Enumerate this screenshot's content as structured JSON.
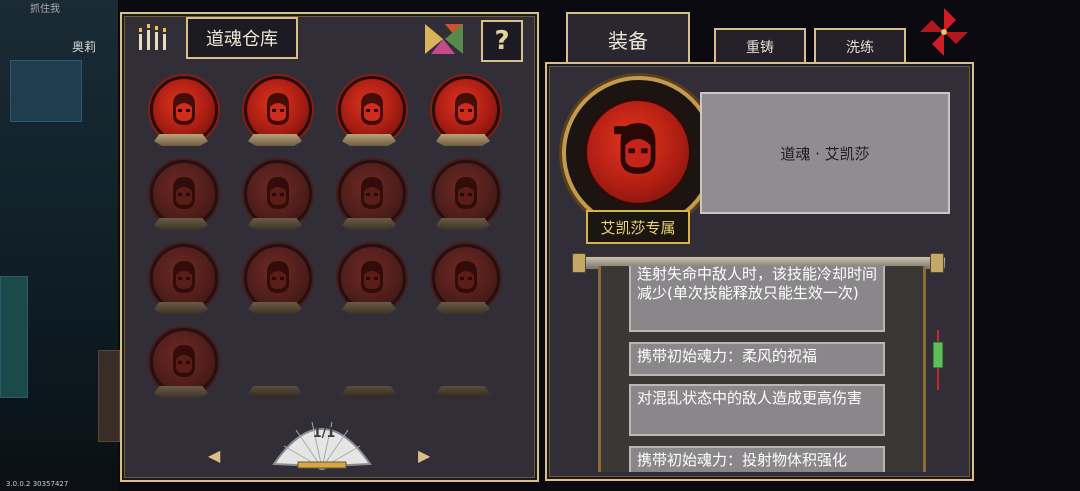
{
  "background": {
    "top_label": "抓住我",
    "player_name": "奥莉"
  },
  "version": "3.0.0.2 30357427",
  "storage": {
    "title": "道魂仓库",
    "help_label": "?",
    "souls": [
      {
        "state": "unlocked"
      },
      {
        "state": "unlocked"
      },
      {
        "state": "unlocked"
      },
      {
        "state": "unlocked"
      },
      {
        "state": "locked"
      },
      {
        "state": "locked"
      },
      {
        "state": "locked"
      },
      {
        "state": "locked"
      },
      {
        "state": "locked"
      },
      {
        "state": "locked"
      },
      {
        "state": "locked"
      },
      {
        "state": "locked"
      },
      {
        "state": "locked"
      },
      {
        "state": "empty"
      },
      {
        "state": "empty"
      },
      {
        "state": "empty"
      }
    ],
    "page": "1/1"
  },
  "tabs": {
    "equip": "装备",
    "recast": "重铸",
    "wash": "洗练"
  },
  "detail": {
    "name": "道魂 · 艾凯莎",
    "exclusive": "艾凯莎专属",
    "effects": [
      "连射失命中敌人时，该技能冷却时间减少(单次技能释放只能生效一次)",
      "携带初始魂力：柔风的祝福",
      "对混乱状态中的敌人造成更高伤害",
      "携带初始魂力：投射物体积强化"
    ]
  },
  "colors": {
    "frame_gold": "#d9c08a",
    "soul_red": "#c4241a",
    "panel_bg": "#312e38",
    "tag_text": "#f1d36f"
  }
}
